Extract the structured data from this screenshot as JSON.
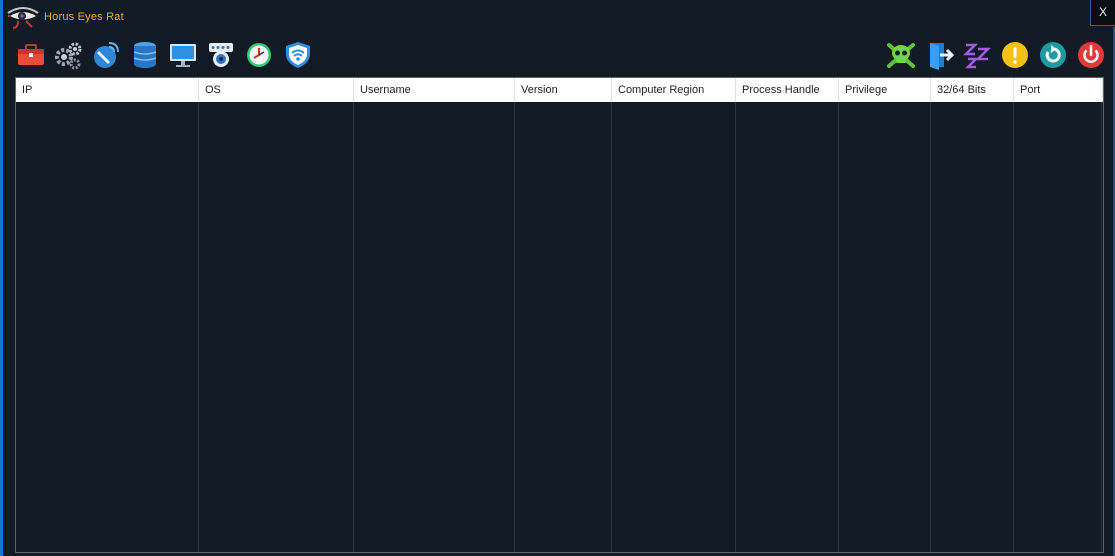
{
  "window": {
    "title": "Horus Eyes Rat",
    "close_label": "X"
  },
  "toolbar": {
    "left": [
      {
        "name": "toolbox-icon"
      },
      {
        "name": "settings-gears-icon"
      },
      {
        "name": "satellite-dish-icon"
      },
      {
        "name": "database-icon"
      },
      {
        "name": "monitor-icon"
      },
      {
        "name": "webcam-icon"
      },
      {
        "name": "clock-icon"
      },
      {
        "name": "shield-wifi-icon"
      }
    ],
    "right": [
      {
        "name": "skull-icon"
      },
      {
        "name": "logout-icon"
      },
      {
        "name": "sleep-icon"
      },
      {
        "name": "warning-icon"
      },
      {
        "name": "restart-icon"
      },
      {
        "name": "power-icon"
      }
    ]
  },
  "table": {
    "columns": [
      "IP",
      "OS",
      "Username",
      "Version",
      "Computer Region",
      "Process Handle",
      "Privilege",
      "32/64 Bits",
      "Port"
    ],
    "rows": []
  },
  "colors": {
    "background": "#111a25",
    "title_text": "#f0a830",
    "accent_strip": "#1e6fd0"
  }
}
